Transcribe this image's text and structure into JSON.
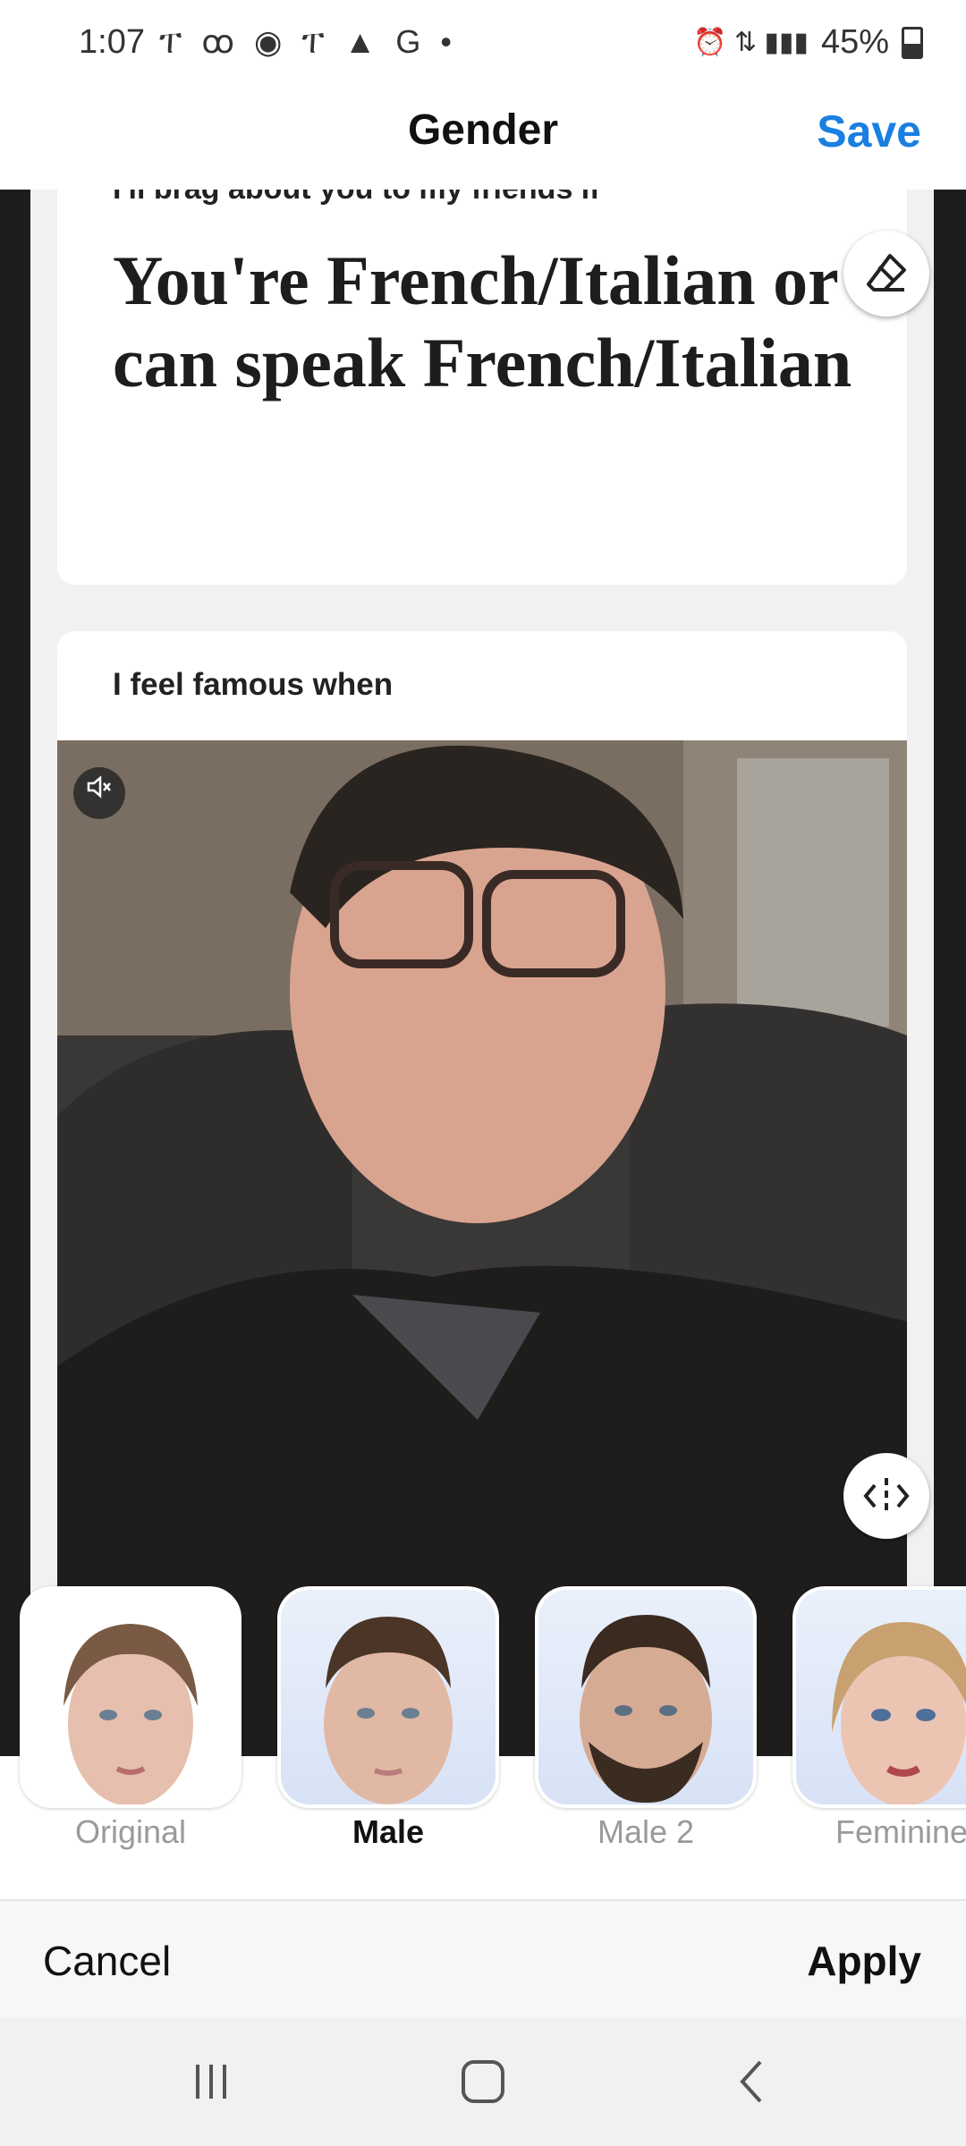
{
  "status_bar": {
    "time": "1:07",
    "left_icons": "ፐ ꝏ ◉ ፐ ▲ G •",
    "battery": "45%",
    "right_icons": "⏰ ⇅ ▮▮▮"
  },
  "header": {
    "title": "Gender",
    "save_label": "Save",
    "save_color": "#1a7fe0"
  },
  "preview": {
    "card1": {
      "prompt": "I'll brag about you to my friends if",
      "answer": "You're French/Italian or can speak French/Italian"
    },
    "card2": {
      "prompt": "I feel famous when"
    },
    "mute_icon": "speaker-muted-icon",
    "eraser_icon": "eraser-icon",
    "compare_icon": "compare-slider-icon"
  },
  "filters": [
    {
      "label": "Original",
      "active": false
    },
    {
      "label": "Male",
      "active": true
    },
    {
      "label": "Male 2",
      "active": false
    },
    {
      "label": "Feminine",
      "active": false
    }
  ],
  "actions": {
    "cancel_label": "Cancel",
    "apply_label": "Apply"
  },
  "nav": {
    "recents_icon": "recents-icon",
    "home_icon": "home-icon",
    "back_icon": "back-icon"
  }
}
